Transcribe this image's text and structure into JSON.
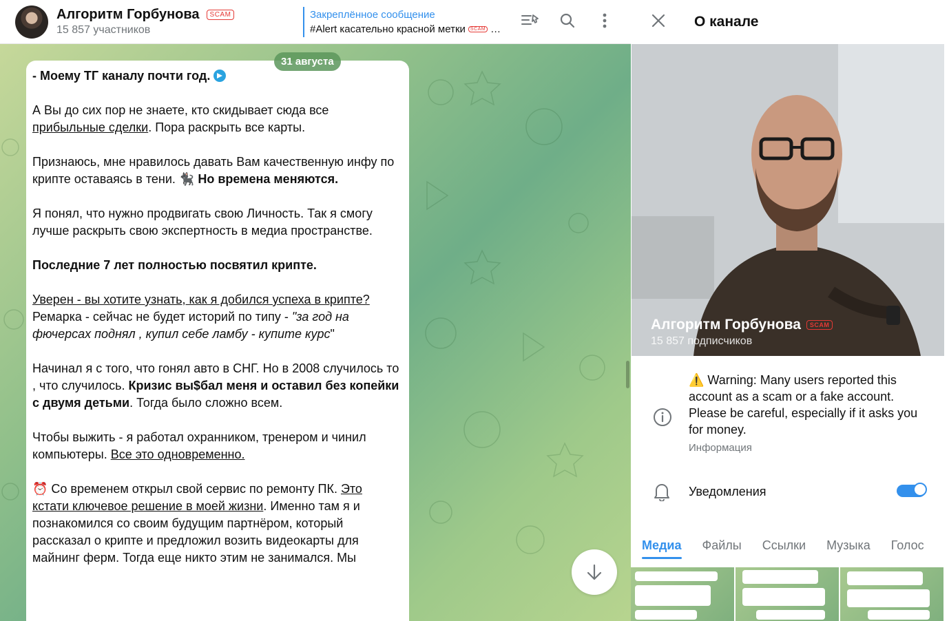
{
  "header": {
    "title": "Алгоритм Горбунова",
    "scam_badge": "SCAM",
    "members": "15 857 участников",
    "pinned_title": "Закреплённое сообщение",
    "pinned_text": "#Alert касательно красной метки"
  },
  "chat": {
    "date_chip": "31 августа",
    "message": {
      "p1_text": "- Моему ТГ каналу почти год.",
      "p2_a": "А Вы до сих пор не знаете, кто скидывает сюда все ",
      "p2_link": "прибыльные сделки",
      "p2_b": ". Пора раскрыть все карты.",
      "p3_a": "Признаюсь, мне нравилось давать Вам качественную инфу по крипте оставаясь в тени. 🐈‍⬛ ",
      "p3_bold": "Но времена меняются.",
      "p4": "Я понял, что нужно продвигать свою Личность. Так я смогу лучше раскрыть свою экспертность в медиа пространстве.",
      "p5_bold": "Последние 7 лет полностью посвятил крипте.",
      "p6_link": "Уверен - вы хотите узнать, как я добился успеха в крипте?",
      "p6_a": " Ремарка - сейчас не будет историй по типу - ",
      "p6_italic": "\"за год на фючерсах поднял , купил себе ламбу - купите курс",
      "p6_end": "\"",
      "p7_a": "Начинал я с того, что гонял авто в СНГ. Но в 2008 случилось то , что случилось. ",
      "p7_bold": "Кризис вы$бал меня и оставил без копейки с двумя детьми",
      "p7_b": ". Тогда было сложно всем.",
      "p8_a": "Чтобы выжить - я работал охранником, тренером и чинил компьютеры. ",
      "p8_link": "Все это одновременно. ",
      "p9_a": "⏰ Со временем открыл свой сервис по ремонту ПК. ",
      "p9_link": "Это кстати ключевое решение в моей жизни",
      "p9_b": ". Именно там я и познакомился со своим будущим партнёром, который рассказал о крипте и предложил возить видеокарты для майнинг ферм. Тогда еще никто этим не занимался. Мы"
    }
  },
  "side": {
    "title": "О канале",
    "photo_name": "Алгоритм Горбунова",
    "photo_badge": "SCAM",
    "photo_sub": "15 857 подписчиков",
    "warning": "⚠️ Warning: Many users reported this account as a scam or a fake account. Please be careful, especially if it asks you for money.",
    "warning_label": "Информация",
    "notifications_label": "Уведомления",
    "notifications_on": true,
    "tabs": [
      "Медиа",
      "Файлы",
      "Ссылки",
      "Музыка",
      "Голос"
    ]
  },
  "colors": {
    "accent": "#3390ec",
    "scam_red": "#e53935",
    "muted": "#707579"
  }
}
